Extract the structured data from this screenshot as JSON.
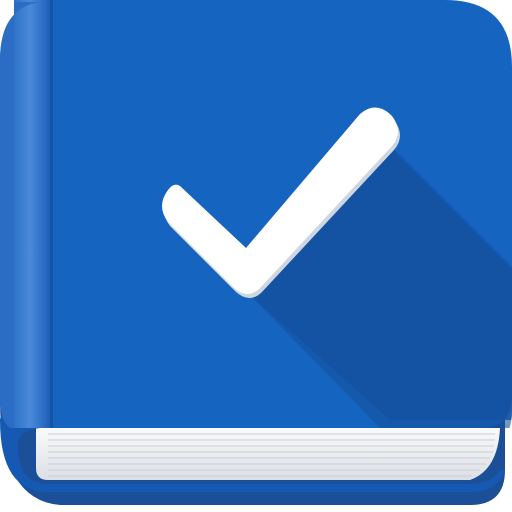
{
  "icon": {
    "name": "checklist-book-app-icon",
    "depicts": [
      "book-icon",
      "checkmark-icon"
    ],
    "colors": {
      "cover": "#1565C0",
      "cover_dark": "#0D47A1",
      "spine_light": "#3F7ED6",
      "checkmark": "#FFFFFF",
      "checkmark_shadow": "#1652A6",
      "pages": "#F2F2F2",
      "page_lines": "#C9CED6"
    }
  }
}
